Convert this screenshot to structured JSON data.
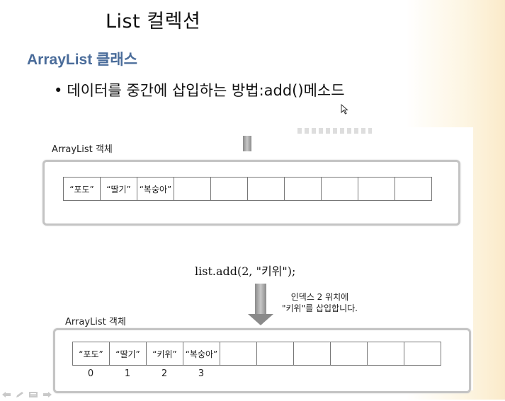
{
  "slide": {
    "title": "List 컬렉션",
    "heading": "ArrayList 클래스",
    "bullet": "데이터를 중간에 삽입하는 방법:add()메소드",
    "bullet_marker": "•"
  },
  "before": {
    "label": "ArrayList 객체",
    "cells": [
      "“포도”",
      "“딸기”",
      "“복숭아”",
      "",
      "",
      "",
      "",
      "",
      "",
      ""
    ]
  },
  "code": "list.add(2, \"키위\");",
  "annotation": {
    "line1": "인덱스 2 위치에",
    "line2": "\"키위\"를 삽입합니다."
  },
  "after": {
    "label": "ArrayList 객체",
    "cells": [
      "“포도”",
      "“딸기”",
      "“키위”",
      "“복숭아”",
      "",
      "",
      "",
      "",
      "",
      ""
    ],
    "indices": [
      "0",
      "1",
      "2",
      "3"
    ]
  },
  "colors": {
    "heading": "#4a6c9a",
    "box_border": "#c4c4c4",
    "arrow": "#8a8a8a"
  },
  "icons": [
    "mouse-cursor-icon",
    "prev-slide-icon",
    "pen-icon",
    "menu-icon",
    "next-slide-icon"
  ]
}
